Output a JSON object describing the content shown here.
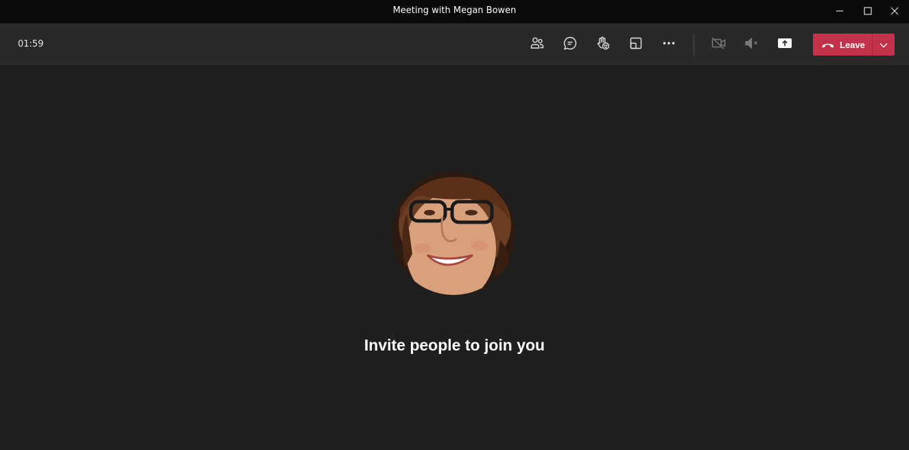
{
  "window": {
    "title": "Meeting with Megan Bowen",
    "controls": [
      "minimize-icon",
      "maximize-icon",
      "close-icon"
    ]
  },
  "toolbar": {
    "timer": "01:59",
    "buttons": [
      "people-icon",
      "chat-icon",
      "raise-hand-icon",
      "rooms-icon",
      "more-icon",
      "camera-off-icon",
      "mic-muted-icon",
      "share-icon"
    ],
    "leave_label": "Leave",
    "leave_color": "#c4314b"
  },
  "stage": {
    "message": "Invite people to join you"
  },
  "colors": {
    "background": "#1f1f1f",
    "toolbar": "#292929",
    "titlebar": "#0a0a0a"
  }
}
